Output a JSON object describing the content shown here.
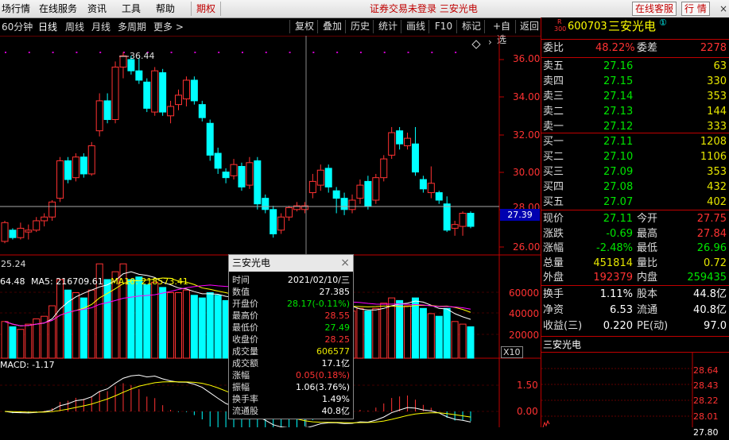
{
  "menubar": {
    "items": [
      "场行情",
      "在线服务",
      "资讯",
      "工具",
      "帮助"
    ],
    "tab_active": "期权",
    "notice": "证券交易未登录  三安光电",
    "service_button": "在线客服",
    "quote_button": "行 情",
    "minimize": "–",
    "restore": "▫",
    "close": "×"
  },
  "toolbar": {
    "periods": [
      "60分钟",
      "日线",
      "周线",
      "月线",
      "多周期",
      "更多 >"
    ],
    "buttons": [
      "复权",
      "叠加",
      "历史",
      "统计",
      "画线",
      "F10",
      "标记",
      "+自选",
      "返回"
    ]
  },
  "chart": {
    "price_axis": [
      "36.00",
      "34.00",
      "32.00",
      "30.00",
      "28.00",
      "26.00"
    ],
    "hover_price_tag": "27.39",
    "high_marker_label": "36.44",
    "low_marker_label": "25.24",
    "vol_label_ma5_prefix": "64.48",
    "vol_label_ma5": "MA5: 216709.61",
    "vol_label_ma10": "MA10: 218573.41",
    "vol_axis": [
      "60000",
      "40000",
      "20000"
    ],
    "vol_unit": "X10",
    "macd_label": "MACD: -1.17",
    "macd_axis": [
      "1.50",
      "0.00"
    ],
    "candles": [
      [
        26.3,
        27.3,
        26.2,
        27.4
      ],
      [
        26.9,
        26.5,
        26.4,
        27.0
      ],
      [
        26.5,
        27.0,
        26.4,
        27.3
      ],
      [
        26.8,
        26.9,
        26.4,
        27.2
      ],
      [
        26.9,
        27.4,
        26.8,
        27.6
      ],
      [
        27.4,
        27.6,
        27.1,
        27.8
      ],
      [
        27.6,
        28.4,
        27.4,
        28.5
      ],
      [
        28.6,
        30.6,
        28.4,
        30.8
      ],
      [
        30.6,
        29.6,
        29.4,
        30.8
      ],
      [
        29.7,
        30.8,
        29.5,
        31.0
      ],
      [
        30.8,
        29.9,
        29.7,
        31.0
      ],
      [
        29.9,
        31.4,
        29.8,
        31.6
      ],
      [
        32.2,
        33.8,
        31.9,
        34.2
      ],
      [
        33.8,
        32.8,
        32.6,
        34.2
      ],
      [
        32.8,
        35.6,
        32.6,
        35.9
      ],
      [
        35.6,
        36.2,
        35.0,
        36.4
      ],
      [
        36.0,
        35.4,
        35.2,
        36.2
      ],
      [
        35.4,
        34.9,
        34.7,
        36.1
      ],
      [
        34.8,
        33.4,
        33.2,
        35.0
      ],
      [
        33.2,
        35.4,
        33.0,
        35.6
      ],
      [
        35.3,
        33.2,
        33.0,
        35.5
      ],
      [
        33.0,
        33.5,
        32.6,
        33.8
      ],
      [
        33.6,
        34.1,
        33.3,
        34.4
      ],
      [
        33.9,
        34.9,
        33.5,
        35.1
      ],
      [
        34.9,
        33.8,
        33.6,
        35.1
      ],
      [
        33.6,
        32.9,
        32.7,
        33.8
      ],
      [
        32.6,
        30.9,
        30.6,
        32.8
      ],
      [
        31.0,
        30.2,
        29.9,
        31.3
      ],
      [
        30.0,
        29.7,
        29.4,
        30.2
      ],
      [
        29.8,
        30.4,
        29.6,
        30.7
      ],
      [
        30.3,
        29.2,
        29.0,
        30.5
      ],
      [
        29.3,
        30.5,
        29.1,
        30.8
      ],
      [
        30.6,
        28.3,
        28.0,
        30.8
      ],
      [
        28.6,
        28.0,
        27.8,
        28.8
      ],
      [
        28.0,
        26.7,
        26.5,
        28.2
      ],
      [
        26.9,
        27.6,
        26.7,
        27.8
      ],
      [
        27.6,
        28.1,
        27.4,
        28.2
      ],
      [
        28.0,
        28.2,
        27.9,
        28.4
      ],
      [
        28.0,
        28.2,
        27.8,
        28.4
      ],
      [
        28.9,
        29.5,
        28.6,
        29.9
      ],
      [
        29.3,
        30.1,
        29.0,
        30.4
      ],
      [
        30.2,
        29.2,
        28.9,
        30.4
      ],
      [
        29.0,
        28.6,
        27.8,
        29.2
      ],
      [
        28.6,
        28.0,
        27.7,
        28.9
      ],
      [
        28.0,
        28.5,
        27.8,
        28.8
      ],
      [
        28.6,
        29.3,
        28.3,
        29.6
      ],
      [
        29.5,
        28.2,
        28.0,
        29.8
      ],
      [
        28.5,
        29.7,
        28.3,
        29.9
      ],
      [
        29.7,
        30.7,
        29.5,
        30.9
      ],
      [
        30.9,
        32.1,
        30.7,
        32.4
      ],
      [
        32.2,
        31.5,
        31.2,
        32.4
      ],
      [
        31.4,
        31.8,
        31.2,
        32.1
      ],
      [
        31.5,
        30.0,
        29.8,
        32.4
      ],
      [
        29.6,
        29.1,
        28.9,
        29.8
      ],
      [
        28.9,
        29.4,
        28.6,
        30.3
      ],
      [
        28.9,
        28.5,
        28.3,
        29.0
      ],
      [
        28.3,
        26.9,
        26.8,
        28.7
      ],
      [
        27.0,
        27.2,
        26.6,
        27.4
      ],
      [
        27.1,
        27.8,
        26.6,
        27.9
      ],
      [
        27.8,
        27.1,
        27.0,
        27.9
      ]
    ],
    "volumes": [
      140,
      120,
      110,
      130,
      150,
      160,
      200,
      300,
      260,
      250,
      230,
      260,
      360,
      300,
      330,
      360,
      300,
      310,
      280,
      290,
      270,
      250,
      250,
      260,
      240,
      230,
      250,
      240,
      220,
      220,
      210,
      230,
      250,
      220,
      240,
      200,
      190,
      180,
      190,
      230,
      240,
      200,
      190,
      180,
      180,
      190,
      180,
      190,
      210,
      230,
      220,
      200,
      230,
      190,
      170,
      160,
      190,
      140,
      130,
      120
    ]
  },
  "quote": {
    "code_prefix": "R",
    "code_sub": "300",
    "code": "600703",
    "name": "三安光电",
    "name_sup": "①",
    "weibi_label": "委比",
    "weibi_value": "48.22%",
    "weicha_label": "委差",
    "weicha_value": "2278",
    "asks": [
      {
        "label": "卖五",
        "price": "27.16",
        "vol": "63"
      },
      {
        "label": "卖四",
        "price": "27.15",
        "vol": "330"
      },
      {
        "label": "卖三",
        "price": "27.14",
        "vol": "353"
      },
      {
        "label": "卖二",
        "price": "27.13",
        "vol": "144"
      },
      {
        "label": "卖一",
        "price": "27.12",
        "vol": "333"
      }
    ],
    "bids": [
      {
        "label": "买一",
        "price": "27.11",
        "vol": "1208"
      },
      {
        "label": "买二",
        "price": "27.10",
        "vol": "1106"
      },
      {
        "label": "买三",
        "price": "27.09",
        "vol": "353"
      },
      {
        "label": "买四",
        "price": "27.08",
        "vol": "432"
      },
      {
        "label": "买五",
        "price": "27.07",
        "vol": "402"
      }
    ],
    "stats1": [
      {
        "l1": "现价",
        "v1": "27.11",
        "c1": "grn",
        "l2": "今开",
        "v2": "27.75",
        "c2": "red"
      },
      {
        "l1": "涨跌",
        "v1": "-0.69",
        "c1": "grn",
        "l2": "最高",
        "v2": "27.84",
        "c2": "red"
      },
      {
        "l1": "涨幅",
        "v1": "-2.48%",
        "c1": "grn",
        "l2": "最低",
        "v2": "26.96",
        "c2": "grn"
      },
      {
        "l1": "总量",
        "v1": "451814",
        "c1": "yel",
        "l2": "量比",
        "v2": "0.72",
        "c2": "yel"
      },
      {
        "l1": "外盘",
        "v1": "192379",
        "c1": "red",
        "l2": "内盘",
        "v2": "259435",
        "c2": "grn"
      }
    ],
    "stats2": [
      {
        "l1": "换手",
        "v1": "1.11%",
        "l2": "股本",
        "v2": "44.8亿"
      },
      {
        "l1": "净资",
        "v1": "6.53",
        "l2": "流通",
        "v2": "40.8亿"
      },
      {
        "l1": "收益(三)",
        "v1": "0.220",
        "l2": "PE(动)",
        "v2": "97.0"
      }
    ],
    "mini_title": "三安光电",
    "mini_axis": [
      "28.64",
      "28.43",
      "28.22",
      "28.01",
      "27.80"
    ]
  },
  "popup": {
    "title": "三安光电",
    "close": "×",
    "rows": [
      {
        "label": "时间",
        "value": "2021/02/10/三",
        "color": "wht"
      },
      {
        "label": "数值",
        "value": "27.385",
        "color": "wht"
      },
      {
        "label": "开盘价",
        "value": "28.17(-0.11%)",
        "color": "grn"
      },
      {
        "label": "最高价",
        "value": "28.55",
        "color": "red"
      },
      {
        "label": "最低价",
        "value": "27.49",
        "color": "grn"
      },
      {
        "label": "收盘价",
        "value": "28.25",
        "color": "red"
      },
      {
        "label": "成交量",
        "value": "606577",
        "color": "yel"
      },
      {
        "label": "成交额",
        "value": "17.1亿",
        "color": "wht"
      },
      {
        "label": "涨幅",
        "value": "0.05(0.18%)",
        "color": "red"
      },
      {
        "label": "振幅",
        "value": "1.06(3.76%)",
        "color": "wht"
      },
      {
        "label": "换手率",
        "value": "1.49%",
        "color": "wht"
      },
      {
        "label": "流通股",
        "value": "40.8亿",
        "color": "wht"
      }
    ]
  },
  "colors": {
    "up": "#ff3232",
    "down": "#00ffff",
    "ma5": "#ffffff",
    "ma10": "#ffff00",
    "ma20": "#ff00ff",
    "grid": "#c00000"
  }
}
